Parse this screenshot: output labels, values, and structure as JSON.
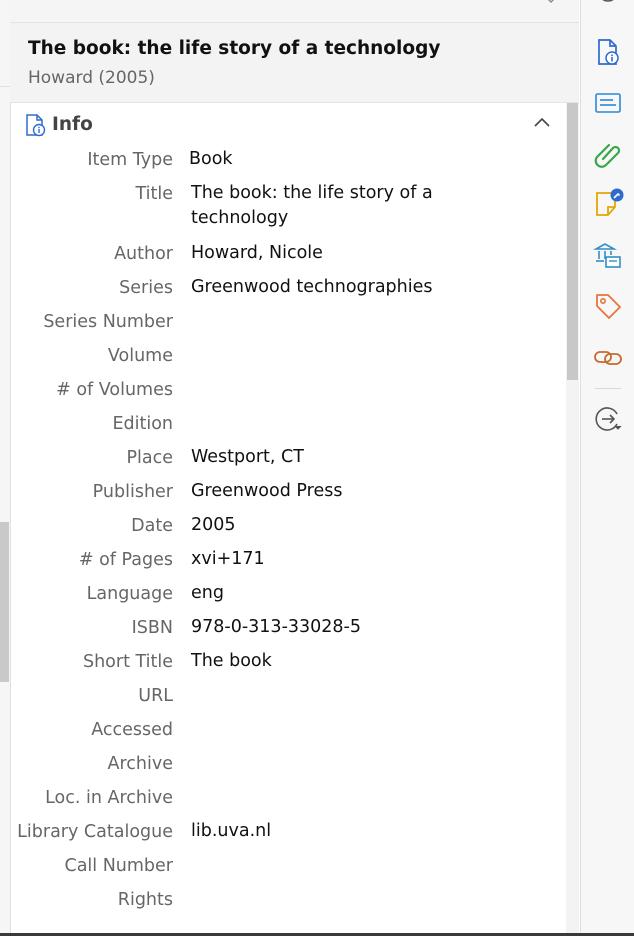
{
  "header": {
    "title": "The book: the life story of a technology",
    "subtitle": "Howard (2005)"
  },
  "section": {
    "title": "Info"
  },
  "fields": [
    {
      "label": "Item Type",
      "value": "Book"
    },
    {
      "label": "Title",
      "value": "The book: the life story of a technology"
    },
    {
      "label": "Author",
      "value": "Howard, Nicole"
    },
    {
      "label": "Series",
      "value": "Greenwood technographies"
    },
    {
      "label": "Series Number",
      "value": ""
    },
    {
      "label": "Volume",
      "value": ""
    },
    {
      "label": "# of Volumes",
      "value": ""
    },
    {
      "label": "Edition",
      "value": ""
    },
    {
      "label": "Place",
      "value": "Westport, CT"
    },
    {
      "label": "Publisher",
      "value": "Greenwood Press"
    },
    {
      "label": "Date",
      "value": "2005"
    },
    {
      "label": "# of Pages",
      "value": "xvi+171"
    },
    {
      "label": "Language",
      "value": "eng"
    },
    {
      "label": "ISBN",
      "value": "978-0-313-33028-5"
    },
    {
      "label": "Short Title",
      "value": "The book"
    },
    {
      "label": "URL",
      "value": ""
    },
    {
      "label": "Accessed",
      "value": ""
    },
    {
      "label": "Archive",
      "value": ""
    },
    {
      "label": "Loc. in Archive",
      "value": ""
    },
    {
      "label": "Library Catalogue",
      "value": "lib.uva.nl"
    },
    {
      "label": "Call Number",
      "value": ""
    },
    {
      "label": "Rights",
      "value": ""
    }
  ],
  "sidenav": [
    {
      "icon": "info-document-icon",
      "color": "#2e6bd1"
    },
    {
      "icon": "abstract-icon",
      "color": "#2e86d1"
    },
    {
      "icon": "attachment-paperclip-icon",
      "color": "#3aa64a"
    },
    {
      "icon": "notes-icon",
      "color": "#e6a700"
    },
    {
      "icon": "libraries-collections-icon",
      "color": "#2f8fc7"
    },
    {
      "icon": "tag-icon",
      "color": "#e8743b"
    },
    {
      "icon": "related-link-icon",
      "color": "#c86a2e"
    },
    {
      "icon": "locate-arrow-icon",
      "color": "#555555"
    }
  ],
  "colors": {
    "accent_blue": "#2e6bd1",
    "label_gray": "#666666"
  }
}
